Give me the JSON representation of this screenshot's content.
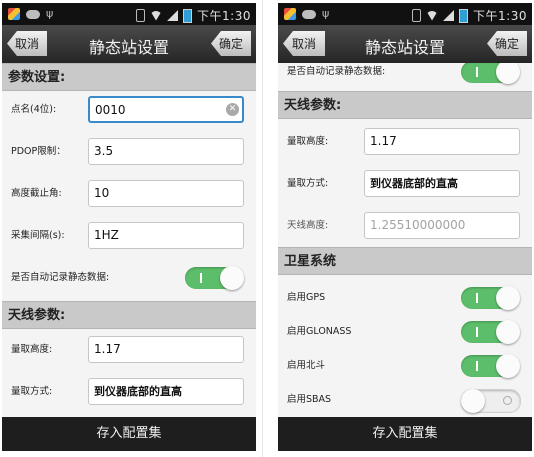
{
  "status": {
    "time": "下午1:30"
  },
  "header": {
    "title": "静态站设置",
    "cancel": "取消",
    "confirm": "确定"
  },
  "left": {
    "section_params": "参数设置:",
    "point_name": {
      "label": "点名(4位):",
      "value": "0010"
    },
    "pdop": {
      "label": "PDOP限制：",
      "value": "3.5"
    },
    "cutoff": {
      "label": "高度截止角:",
      "value": "10"
    },
    "interval": {
      "label": "采集间隔(s):",
      "value": "1HZ"
    },
    "auto_record": {
      "label": "是否自动记录静态数据:",
      "on": true
    },
    "section_antenna": "天线参数:",
    "measure_height": {
      "label": "量取高度:",
      "value": "1.17"
    },
    "measure_method": {
      "label": "量取方式:",
      "value": "到仪器底部的直高"
    }
  },
  "right": {
    "auto_record": {
      "label": "是否自动记录静态数据:",
      "on": true
    },
    "section_antenna": "天线参数:",
    "measure_height": {
      "label": "量取高度:",
      "value": "1.17"
    },
    "measure_method": {
      "label": "量取方式:",
      "value": "到仪器底部的直高"
    },
    "antenna_height": {
      "label": "天线高度:",
      "value": "1.25510000000"
    },
    "section_sat": "卫星系统",
    "gps": {
      "label": "启用GPS",
      "on": true
    },
    "glonass": {
      "label": "启用GLONASS",
      "on": true
    },
    "beidou": {
      "label": "启用北斗",
      "on": true
    },
    "sbas": {
      "label": "启用SBAS",
      "on": false
    }
  },
  "footer": {
    "save": "存入配置集"
  },
  "colors": {
    "accent_green": "#5cbe6a",
    "focus_blue": "#3a89c9",
    "titlebar": "#333333"
  }
}
